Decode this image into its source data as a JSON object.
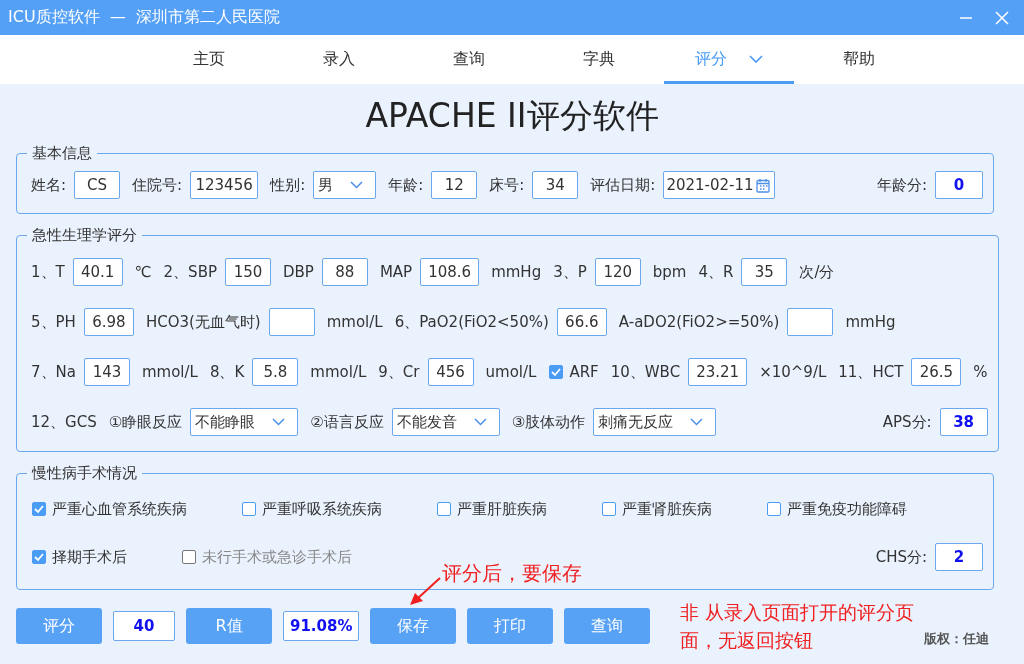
{
  "window": {
    "title": "ICU质控软件  —  深圳市第二人民医院"
  },
  "tabs": [
    {
      "label": "主页",
      "selected": false,
      "menu": false
    },
    {
      "label": "录入",
      "selected": false,
      "menu": false
    },
    {
      "label": "查询",
      "selected": false,
      "menu": false
    },
    {
      "label": "字典",
      "selected": false,
      "menu": false
    },
    {
      "label": "评分",
      "selected": true,
      "menu": true
    },
    {
      "label": "帮助",
      "selected": false,
      "menu": false
    }
  ],
  "heading": "APACHE II评分软件",
  "basic": {
    "legend": "基本信息",
    "lines": [
      {
        "items": [
          {
            "kind": "label",
            "text": "姓名:"
          },
          {
            "kind": "field",
            "value": "CS"
          },
          {
            "kind": "label",
            "text": "住院号:"
          },
          {
            "kind": "field",
            "value": "123456"
          },
          {
            "kind": "label",
            "text": "性别:"
          },
          {
            "kind": "select",
            "value": "男"
          },
          {
            "kind": "label",
            "text": "年龄:"
          },
          {
            "kind": "field",
            "value": "12"
          },
          {
            "kind": "label",
            "text": "床号:"
          },
          {
            "kind": "field",
            "value": "34"
          },
          {
            "kind": "label",
            "text": "评估日期:"
          },
          {
            "kind": "date",
            "value": "2021-02-11"
          },
          {
            "kind": "score",
            "label": "年龄分:",
            "value": "0"
          }
        ]
      }
    ]
  },
  "aps": {
    "legend": "急性生理学评分",
    "lines": [
      {
        "items": [
          {
            "kind": "label",
            "text": "1、T"
          },
          {
            "kind": "field",
            "value": "40.1"
          },
          {
            "kind": "label",
            "text": "℃"
          },
          {
            "kind": "label",
            "text": "2、SBP"
          },
          {
            "kind": "field",
            "value": "150"
          },
          {
            "kind": "label",
            "text": "DBP"
          },
          {
            "kind": "field",
            "value": "88"
          },
          {
            "kind": "label",
            "text": "MAP"
          },
          {
            "kind": "field",
            "value": "108.6"
          },
          {
            "kind": "label",
            "text": "mmHg"
          },
          {
            "kind": "label",
            "text": "3、P"
          },
          {
            "kind": "field",
            "value": "120"
          },
          {
            "kind": "label",
            "text": "bpm"
          },
          {
            "kind": "label",
            "text": "4、R"
          },
          {
            "kind": "field",
            "value": "35"
          },
          {
            "kind": "label",
            "text": "次/分"
          }
        ]
      },
      {
        "items": [
          {
            "kind": "label",
            "text": "5、PH"
          },
          {
            "kind": "field",
            "value": "6.98"
          },
          {
            "kind": "label",
            "text": "HCO3(无血气时)"
          },
          {
            "kind": "field"
          },
          {
            "kind": "label",
            "text": "mmol/L"
          },
          {
            "kind": "label",
            "text": "6、PaO2(FiO2<50%)"
          },
          {
            "kind": "field",
            "value": "66.6"
          },
          {
            "kind": "label",
            "text": "A-aDO2(FiO2>=50%)"
          },
          {
            "kind": "field"
          },
          {
            "kind": "label",
            "text": "mmHg"
          }
        ]
      },
      {
        "items": [
          {
            "kind": "label",
            "text": "7、Na"
          },
          {
            "kind": "field",
            "value": "143"
          },
          {
            "kind": "label",
            "text": "mmol/L"
          },
          {
            "kind": "label",
            "text": "8、K"
          },
          {
            "kind": "field",
            "value": "5.8"
          },
          {
            "kind": "label",
            "text": "mmol/L"
          },
          {
            "kind": "label",
            "text": "9、Cr"
          },
          {
            "kind": "field",
            "value": "456"
          },
          {
            "kind": "label",
            "text": "umol/L"
          },
          {
            "kind": "check",
            "label": "ARF",
            "checked": true,
            "disabled": false
          },
          {
            "kind": "label",
            "text": "10、WBC"
          },
          {
            "kind": "field",
            "value": "23.21"
          },
          {
            "kind": "label",
            "text": "×10^9/L"
          },
          {
            "kind": "label",
            "text": "11、HCT"
          },
          {
            "kind": "field",
            "value": "26.5"
          },
          {
            "kind": "label",
            "text": "%"
          }
        ]
      },
      {
        "items": [
          {
            "kind": "label",
            "text": "12、GCS"
          },
          {
            "kind": "label",
            "text": "①睁眼反应"
          },
          {
            "kind": "select",
            "value": "不能睁眼"
          },
          {
            "kind": "label",
            "text": "②语言反应"
          },
          {
            "kind": "select",
            "value": "不能发音"
          },
          {
            "kind": "label",
            "text": "③肢体动作"
          },
          {
            "kind": "select",
            "value": "刺痛无反应"
          },
          {
            "kind": "score",
            "label": "APS分:",
            "value": "38"
          }
        ]
      }
    ]
  },
  "chronic": {
    "legend": "慢性病手术情况",
    "lines": [
      {
        "items": [
          {
            "kind": "check",
            "label": "严重心血管系统疾病",
            "checked": true,
            "disabled": false
          },
          {
            "kind": "check",
            "label": "严重呼吸系统疾病",
            "checked": false,
            "disabled": false
          },
          {
            "kind": "check",
            "label": "严重肝脏疾病",
            "checked": false,
            "disabled": false
          },
          {
            "kind": "check",
            "label": "严重肾脏疾病",
            "checked": false,
            "disabled": false
          },
          {
            "kind": "check",
            "label": "严重免疫功能障碍",
            "checked": false,
            "disabled": false
          }
        ]
      },
      {
        "items": [
          {
            "kind": "check",
            "label": "择期手术后",
            "checked": true,
            "disabled": false
          },
          {
            "kind": "check",
            "label": "未行手术或急诊手术后",
            "checked": false,
            "disabled": true
          },
          {
            "kind": "score",
            "label": "CHS分:",
            "value": "2"
          }
        ]
      }
    ]
  },
  "actions": [
    {
      "kind": "button",
      "text": "评分"
    },
    {
      "kind": "output",
      "value": "40"
    },
    {
      "kind": "button",
      "text": "R值"
    },
    {
      "kind": "output",
      "value": "91.08%"
    },
    {
      "kind": "button",
      "text": "保存"
    },
    {
      "kind": "button",
      "text": "打印"
    },
    {
      "kind": "button",
      "text": "查询"
    }
  ],
  "notes": [
    {
      "kind": "arrow",
      "text": "评分后，要保存"
    },
    {
      "kind": "block",
      "text": "非 从录入页面打开的评分页面，无返回按钮"
    }
  ],
  "copyright": "版权：任迪"
}
